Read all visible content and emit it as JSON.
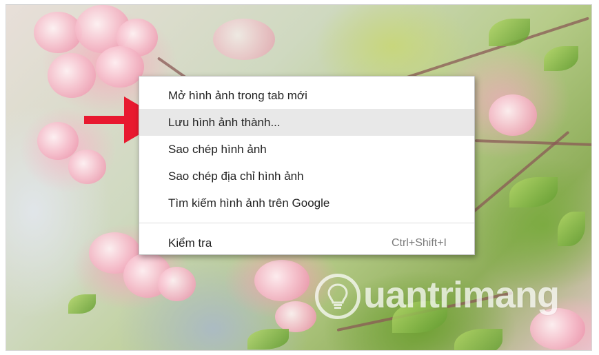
{
  "context_menu": {
    "items": [
      {
        "label": "Mở hình ảnh trong tab mới",
        "highlighted": false
      },
      {
        "label": "Lưu hình ảnh thành...",
        "highlighted": true
      },
      {
        "label": "Sao chép hình ảnh",
        "highlighted": false
      },
      {
        "label": "Sao chép địa chỉ hình ảnh",
        "highlighted": false
      },
      {
        "label": "Tìm kiếm hình ảnh trên Google",
        "highlighted": false
      }
    ],
    "inspect": {
      "label": "Kiểm tra",
      "shortcut": "Ctrl+Shift+I"
    }
  },
  "annotation": {
    "arrow_color": "#e8192f",
    "points_to": "Lưu hình ảnh thành..."
  },
  "watermark": {
    "text": "uantrimang",
    "icon": "lightbulb-icon"
  },
  "colors": {
    "highlight": "#e8e8e8",
    "menu_bg": "#ffffff",
    "shortcut_text": "#7a7a7a"
  }
}
